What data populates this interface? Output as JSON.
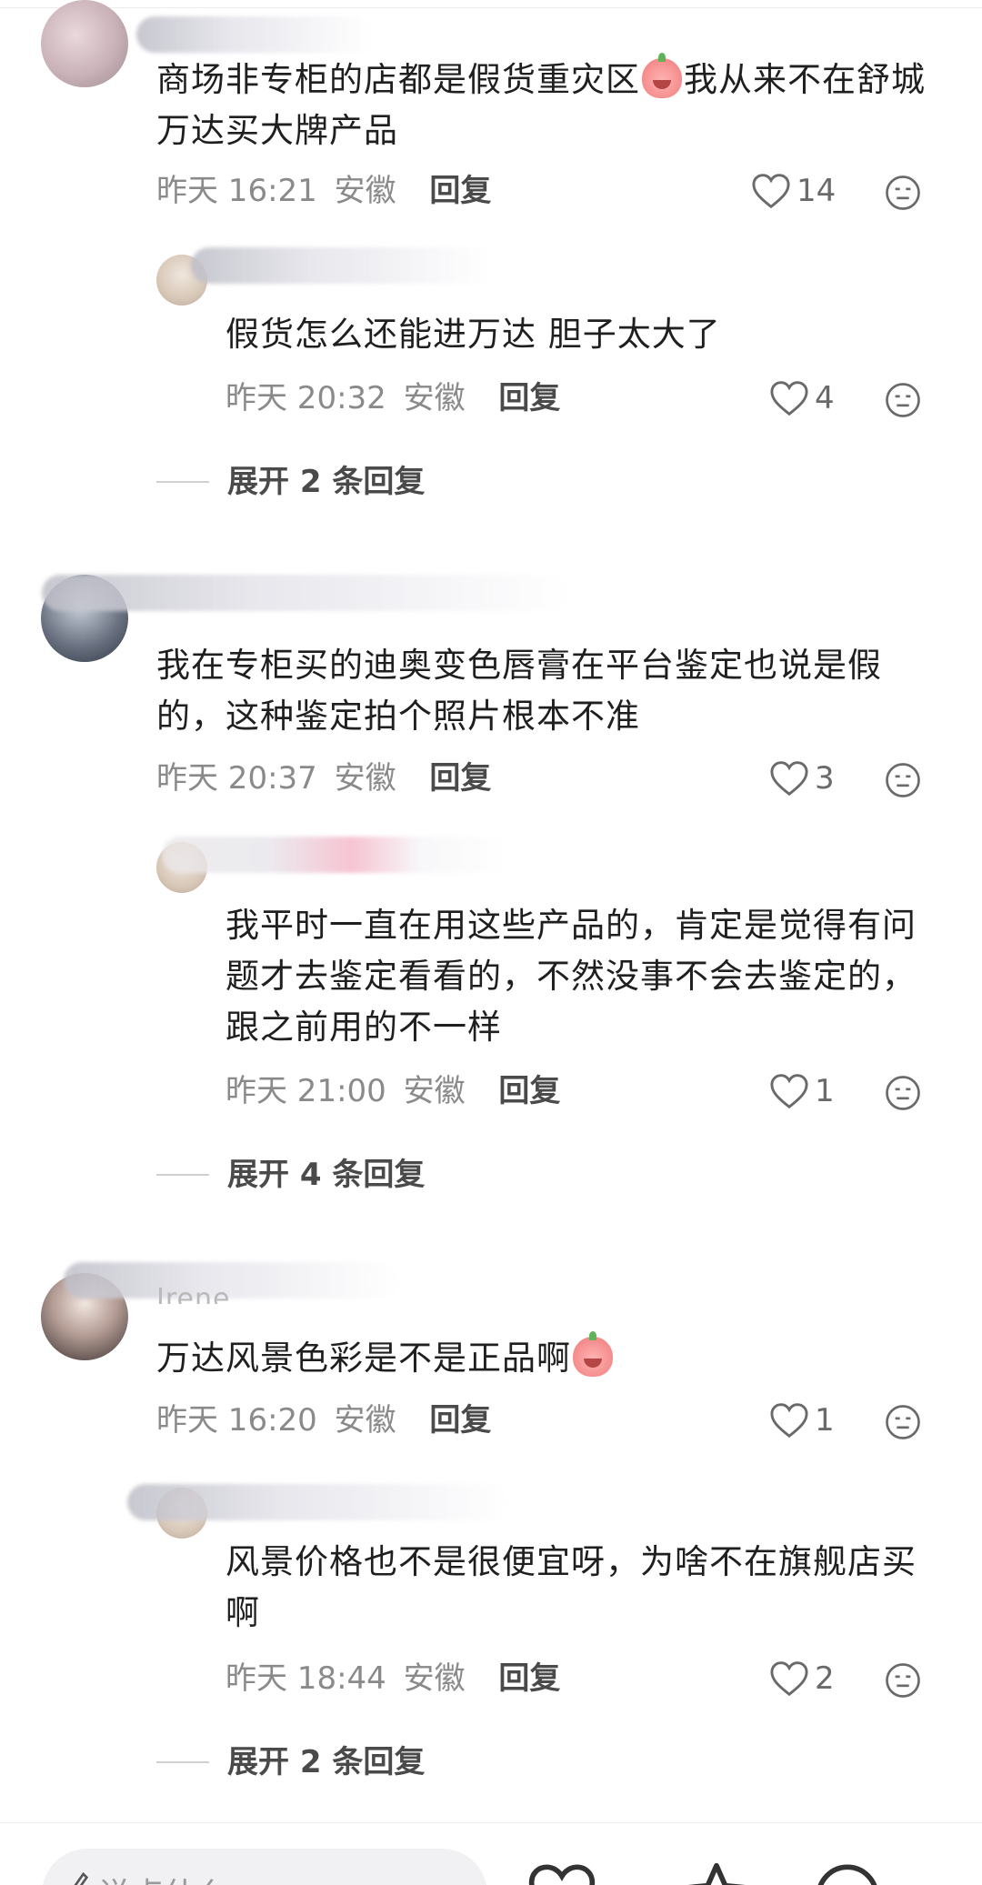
{
  "comments": [
    {
      "name_peek": "",
      "text": "商场非专柜的店都是假货重灾区",
      "text_after_emoji": "我从来不在舒城万达买大牌产品",
      "time": "昨天 16:21",
      "location": "安徽",
      "reply_label": "回复",
      "likes": "14",
      "replies": [
        {
          "text": "假货怎么还能进万达 胆子太大了",
          "time": "昨天 20:32",
          "location": "安徽",
          "reply_label": "回复",
          "likes": "4"
        }
      ],
      "expand_label": "展开 2 条回复"
    },
    {
      "name_peek": "",
      "text": "我在专柜买的迪奥变色唇膏在平台鉴定也说是假的，这种鉴定拍个照片根本不准",
      "time": "昨天 20:37",
      "location": "安徽",
      "reply_label": "回复",
      "likes": "3",
      "replies": [
        {
          "text": "我平时一直在用这些产品的，肯定是觉得有问题才去鉴定看看的，不然没事不会去鉴定的，跟之前用的不一样",
          "time": "昨天 21:00",
          "location": "安徽",
          "reply_label": "回复",
          "likes": "1"
        }
      ],
      "expand_label": "展开 4 条回复"
    },
    {
      "name_peek": "Irene",
      "text": "万达风景色彩是不是正品啊",
      "time": "昨天 16:20",
      "location": "安徽",
      "reply_label": "回复",
      "likes": "1",
      "replies": [
        {
          "text": "风景价格也不是很便宜呀，为啥不在旗舰店买啊",
          "time": "昨天 18:44",
          "location": "安徽",
          "reply_label": "回复",
          "likes": "2"
        }
      ],
      "expand_label": "展开 2 条回复"
    }
  ],
  "bottom_bar": {
    "input_placeholder": "说点什么"
  },
  "colors": {
    "text": "#1f1f1f",
    "meta": "#8a8a8a",
    "reply": "#4a4a4a",
    "background": "#ffffff"
  }
}
